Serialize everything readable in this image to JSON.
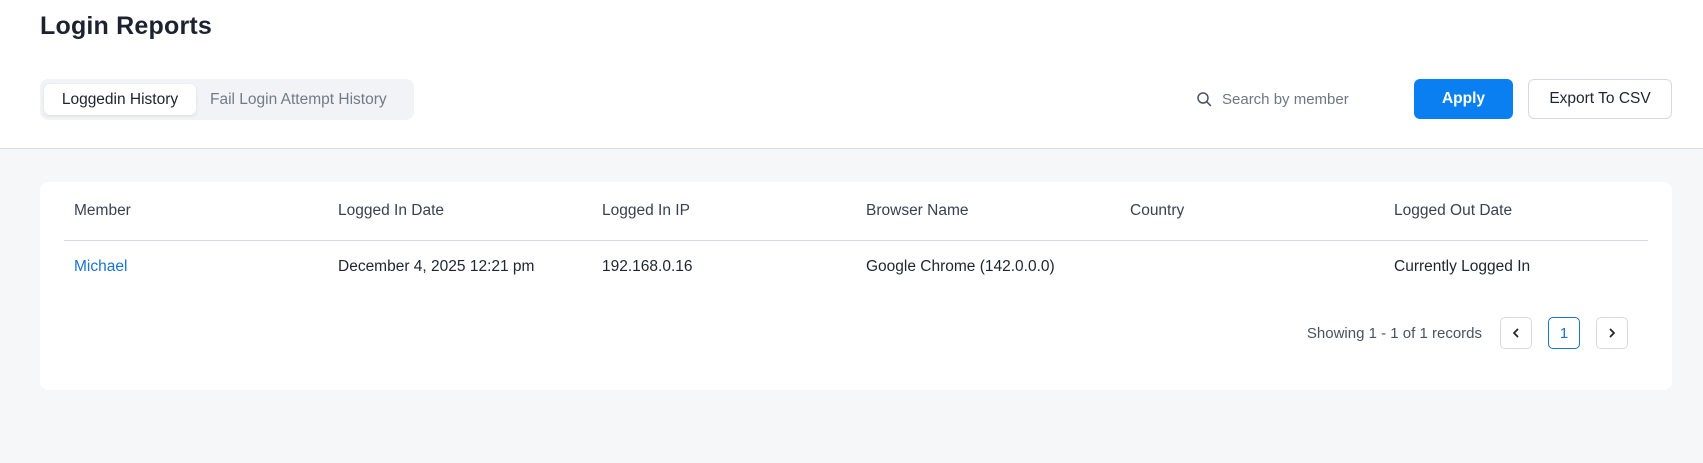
{
  "page": {
    "title": "Login Reports"
  },
  "tabs": [
    {
      "label": "Loggedin History",
      "active": true
    },
    {
      "label": "Fail Login Attempt History",
      "active": false
    }
  ],
  "search": {
    "placeholder": "Search by member",
    "value": "",
    "icon": "search-icon"
  },
  "toolbar": {
    "apply_label": "Apply",
    "export_label": "Export To CSV"
  },
  "table": {
    "columns": [
      "Member",
      "Logged In Date",
      "Logged In IP",
      "Browser Name",
      "Country",
      "Logged Out Date"
    ],
    "rows": [
      {
        "member": "Michael",
        "logged_in_date": "December 4, 2025 12:21 pm",
        "logged_in_ip": "192.168.0.16",
        "browser_name": "Google Chrome (142.0.0.0)",
        "country": "",
        "logged_out_date": "Currently Logged In"
      }
    ]
  },
  "pagination": {
    "summary": "Showing 1 - 1 of 1 records",
    "current_page": "1",
    "prev_icon": "chevron-left-icon",
    "next_icon": "chevron-right-icon"
  },
  "colors": {
    "accent": "#0a7ff2",
    "link": "#1a74d2",
    "background": "#f6f7f9"
  }
}
